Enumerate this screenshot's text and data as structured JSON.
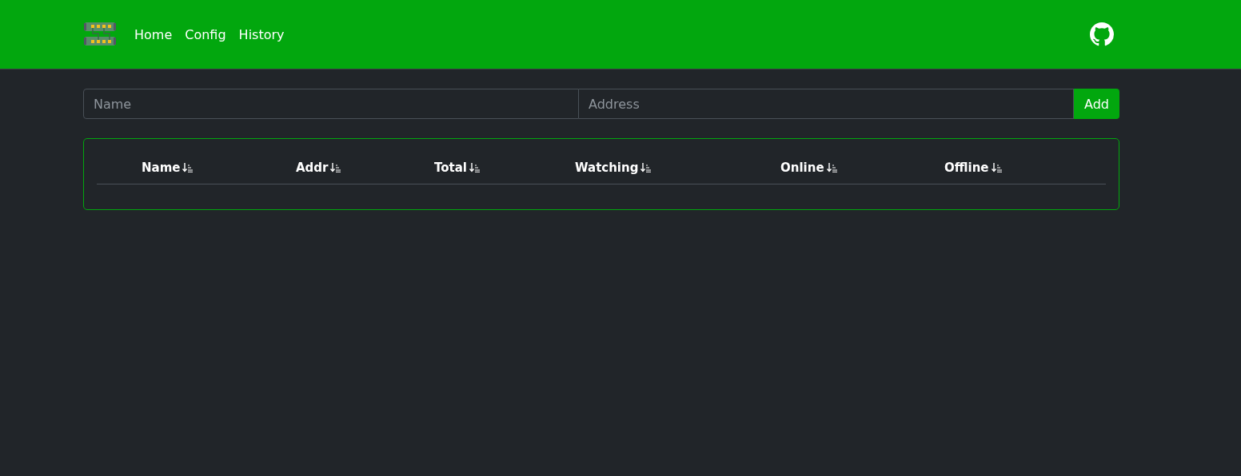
{
  "navbar": {
    "links": [
      {
        "label": "Home"
      },
      {
        "label": "Config"
      },
      {
        "label": "History"
      }
    ]
  },
  "form": {
    "name_placeholder": "Name",
    "address_placeholder": "Address",
    "button": "Add"
  },
  "table": {
    "columns": [
      {
        "label": "Name"
      },
      {
        "label": "Addr"
      },
      {
        "label": "Total"
      },
      {
        "label": "Watching"
      },
      {
        "label": "Online"
      },
      {
        "label": "Offline"
      }
    ]
  }
}
